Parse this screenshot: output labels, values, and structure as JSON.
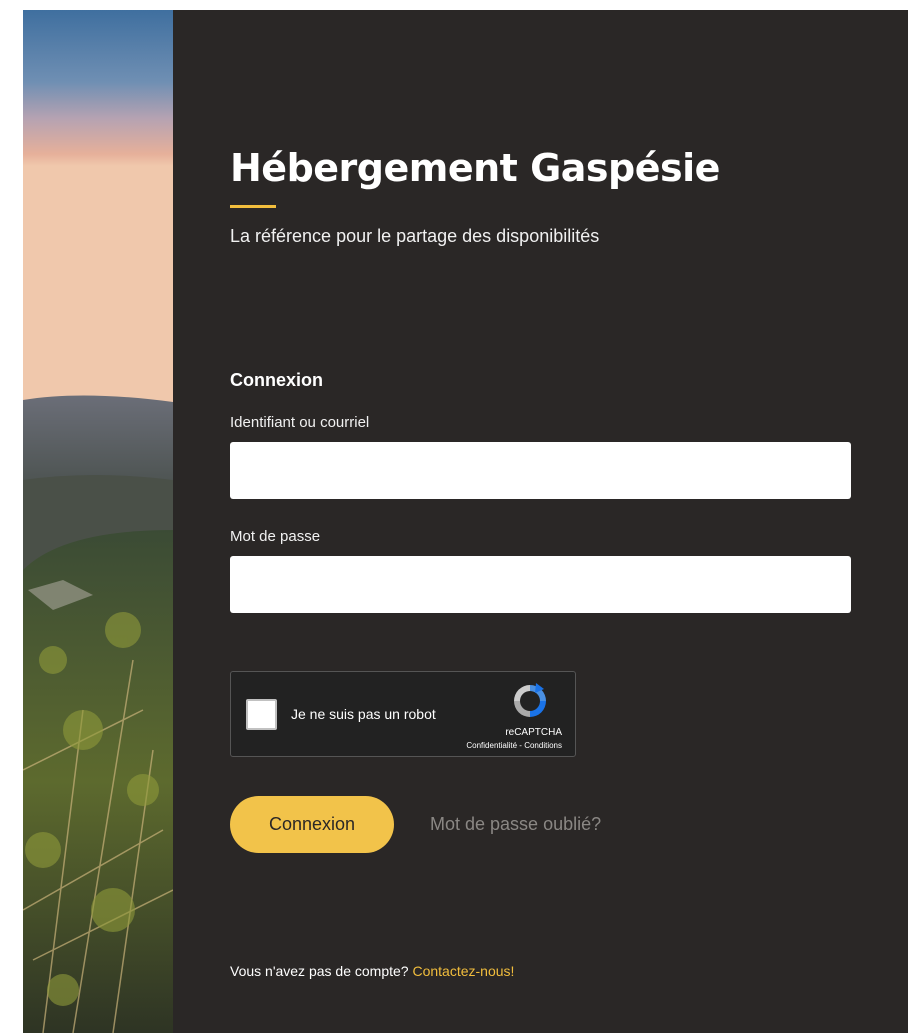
{
  "brand": {
    "title": "Hébergement Gaspésie",
    "tagline": "La référence pour le partage des disponibilités",
    "accent_color": "#f2be3d",
    "panel_color": "#2a2726"
  },
  "login": {
    "heading": "Connexion",
    "username_label": "Identifiant ou courriel",
    "username_value": "",
    "password_label": "Mot de passe",
    "password_value": "",
    "submit_label": "Connexion",
    "forgot_label": "Mot de passe oublié?"
  },
  "recaptcha": {
    "label": "Je ne suis pas un robot",
    "brand": "reCAPTCHA",
    "privacy": "Confidentialité",
    "separator": " - ",
    "terms": "Conditions",
    "checked": false,
    "icon": "recaptcha-logo"
  },
  "signup": {
    "prompt": "Vous n'avez pas de compte?",
    "link_label": "Contactez-nous!"
  }
}
